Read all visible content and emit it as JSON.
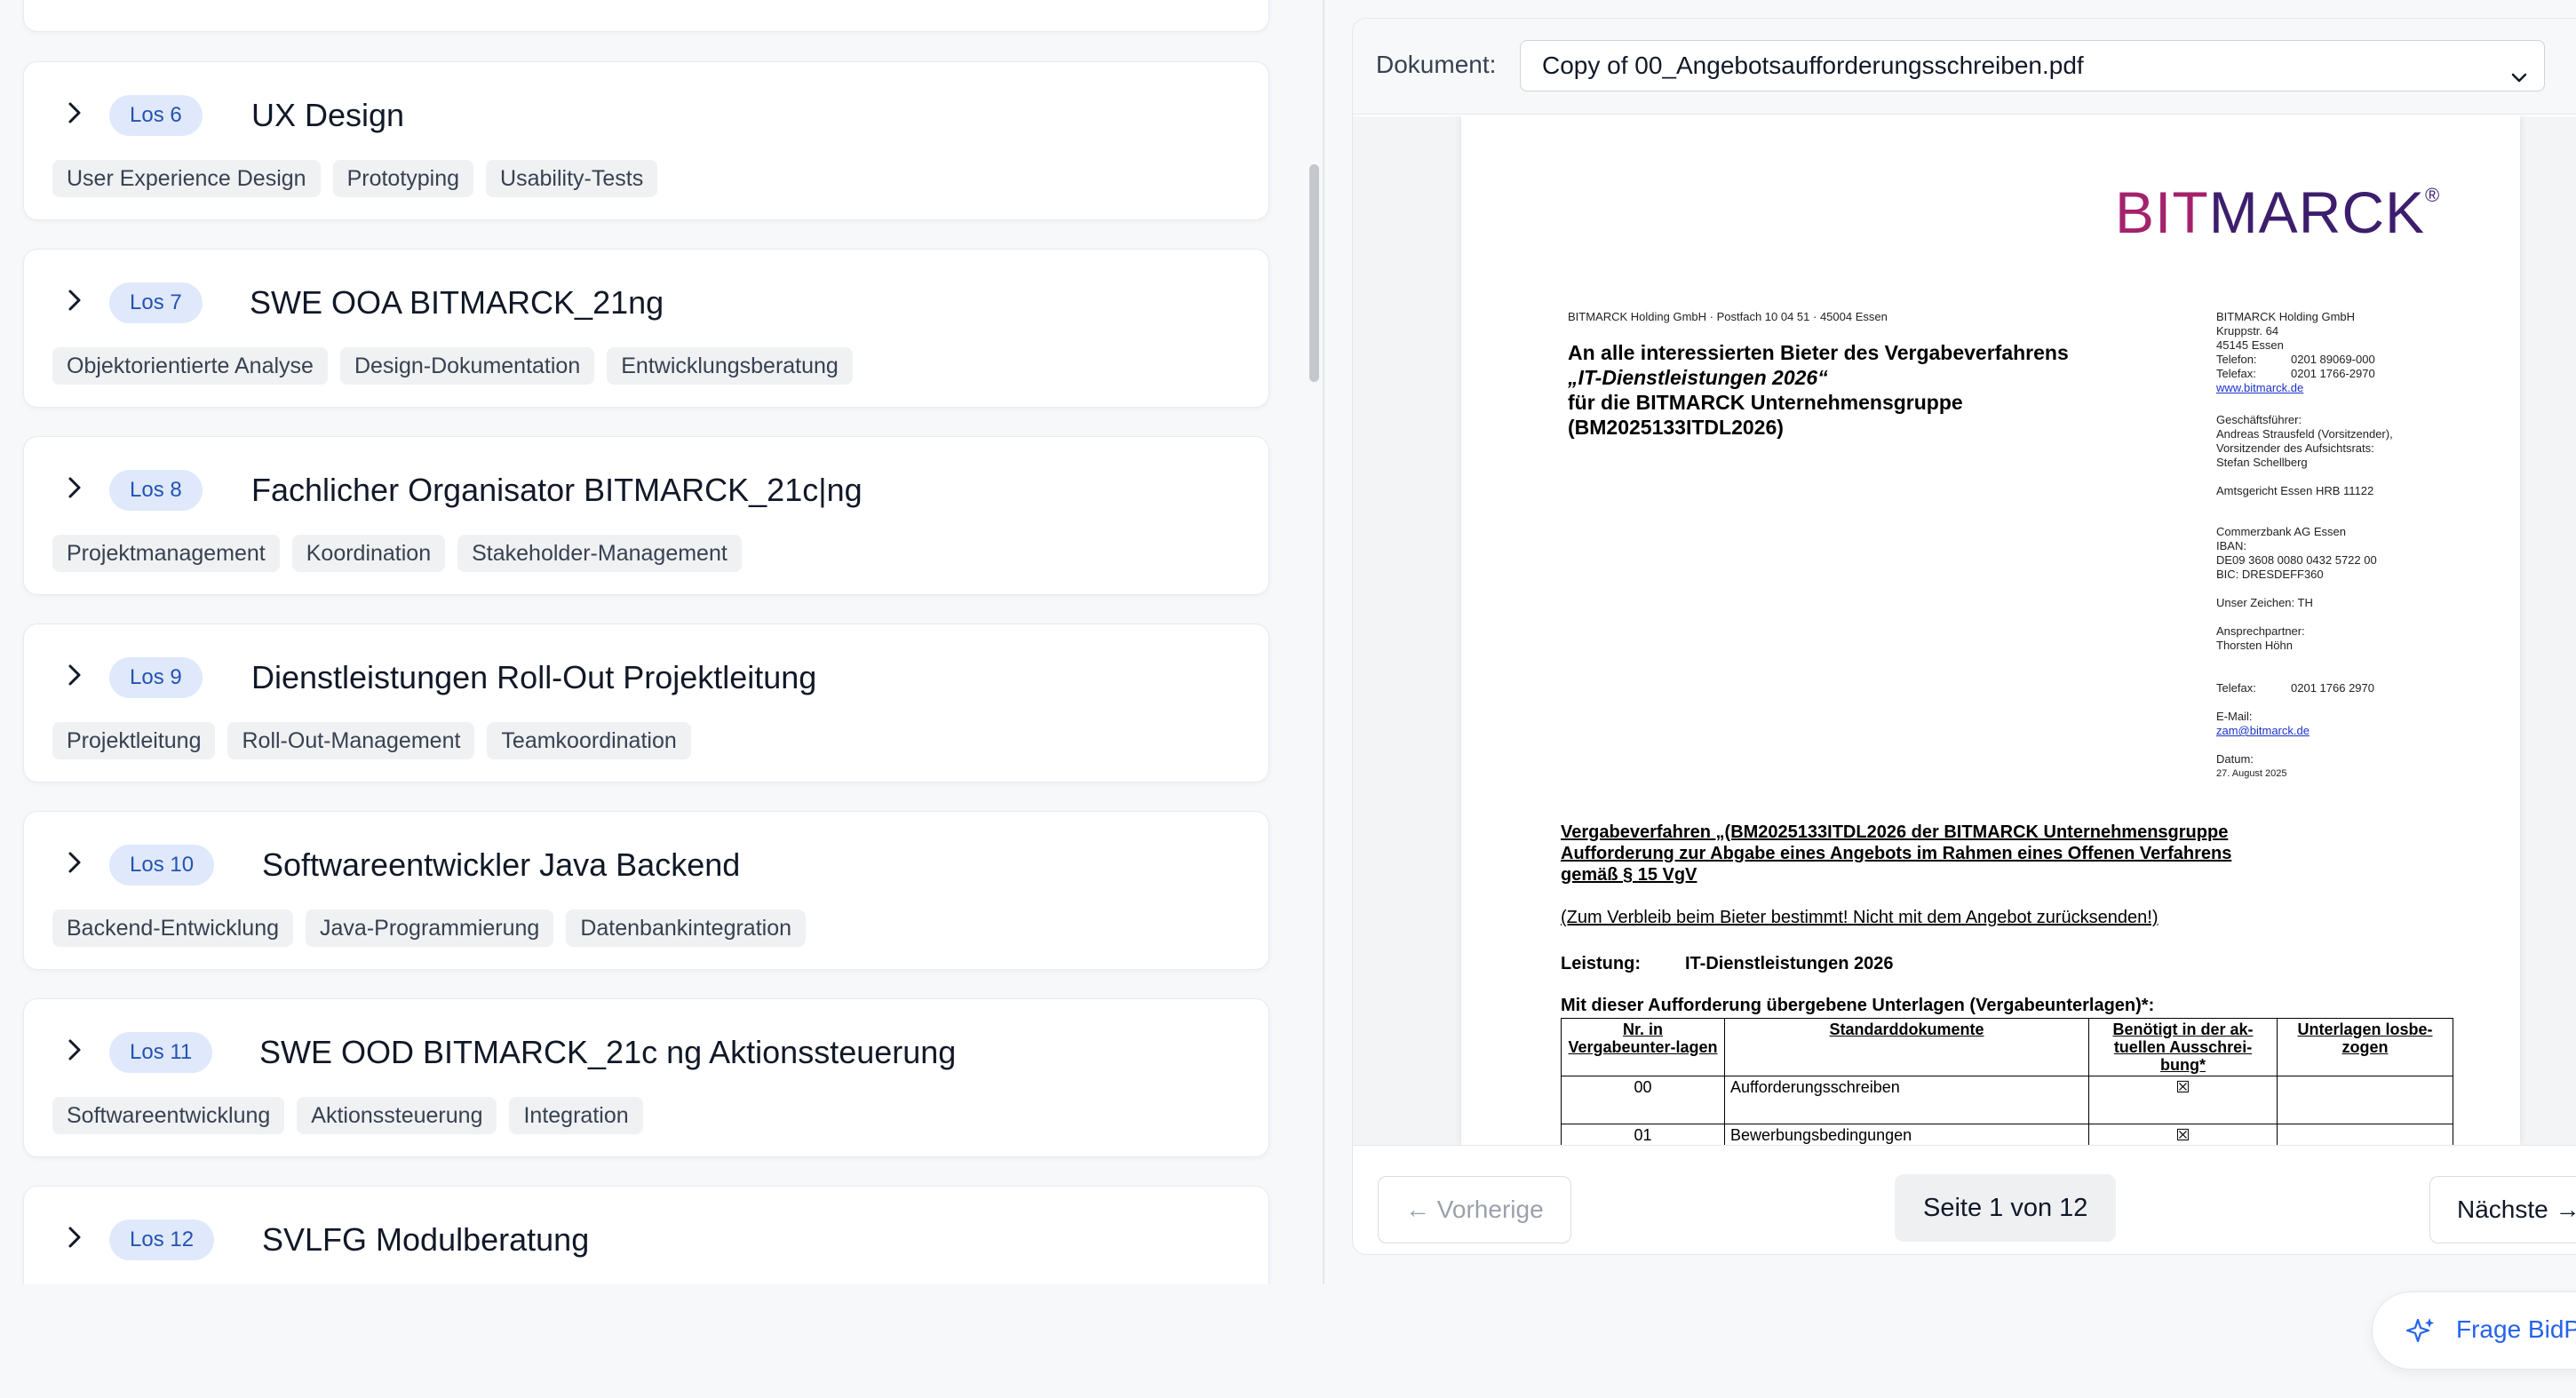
{
  "lose": [
    {
      "badge": "Los 6",
      "title": "UX Design",
      "tags": [
        "User Experience Design",
        "Prototyping",
        "Usability-Tests"
      ]
    },
    {
      "badge": "Los 7",
      "title": "SWE OOA BITMARCK_21ng",
      "tags": [
        "Objektorientierte Analyse",
        "Design-Dokumentation",
        "Entwicklungsberatung"
      ]
    },
    {
      "badge": "Los 8",
      "title": "Fachlicher Organisator BITMARCK_21c|ng",
      "tags": [
        "Projektmanagement",
        "Koordination",
        "Stakeholder-Management"
      ]
    },
    {
      "badge": "Los 9",
      "title": "Dienstleistungen Roll-Out Projektleitung",
      "tags": [
        "Projektleitung",
        "Roll-Out-Management",
        "Teamkoordination"
      ]
    },
    {
      "badge": "Los 10",
      "title": "Softwareentwickler Java Backend",
      "tags": [
        "Backend-Entwicklung",
        "Java-Programmierung",
        "Datenbankintegration"
      ]
    },
    {
      "badge": "Los 11",
      "title": "SWE OOD BITMARCK_21c ng Aktionssteuerung",
      "tags": [
        "Softwareentwicklung",
        "Aktionssteuerung",
        "Integration"
      ]
    },
    {
      "badge": "Los 12",
      "title": "SVLFG Modulberatung",
      "tags": []
    }
  ],
  "document": {
    "label": "Dokument:",
    "selected": "Copy of 00_Angebotsaufforderungsschreiben.pdf"
  },
  "pdf": {
    "logo_bit": "BIT",
    "logo_marck": "MARCK",
    "logo_reg": "®",
    "sender_line": "BITMARCK Holding GmbH · Postfach 10 04 51 · 45004 Essen",
    "recipient": [
      "An alle interessierten Bieter des Vergabeverfahrens",
      "„IT-Dienstleistungen 2026“",
      "für die BITMARCK Unternehmensgruppe",
      "(BM2025133ITDL2026)"
    ],
    "address": [
      "BITMARCK Holding GmbH",
      "Kruppstr. 64",
      "45145 Essen",
      "Telefon:",
      "0201 89069-000",
      "Telefax:",
      "0201 1766-2970",
      "www.bitmarck.de"
    ],
    "management": [
      "Geschäftsführer:",
      "Andreas Strausfeld (Vorsitzender),",
      "Vorsitzender des Aufsichtsrats:",
      "Stefan Schellberg"
    ],
    "court": "Amtsgericht Essen HRB 11122",
    "bank": [
      "Commerzbank AG Essen",
      "IBAN:",
      "DE09 3608 0080 0432 5722 00",
      "BIC: DRESDEFF360"
    ],
    "reference": "Unser Zeichen: TH",
    "contact": [
      "Ansprechpartner:",
      "Thorsten Höhn"
    ],
    "fax_label": "Telefax:",
    "fax_value": "0201 1766 2970",
    "email_label": "E-Mail:",
    "email": "zam@bitmarck.de",
    "date_label": "Datum:",
    "date": "27. August 2025",
    "subject": [
      "Vergabeverfahren „(BM2025133ITDL2026 der BITMARCK Unternehmensgruppe",
      "Aufforderung zur Abgabe eines Angebots im Rahmen eines Offenen Verfahrens",
      "gemäß § 15 VgV"
    ],
    "note": "(Zum Verbleib beim Bieter bestimmt! Nicht mit dem Angebot zurücksenden!)",
    "leistung_label": "Leistung:",
    "leistung_value": "IT-Dienstleistungen 2026",
    "table_intro": "Mit dieser Aufforderung übergebene Unterlagen (Vergabeunterlagen)*:",
    "table_headers": [
      "Nr. in Vergabeunter-lagen",
      "Standarddokumente",
      "Benötigt in der ak-tuellen Ausschrei-bung*",
      "Unterlagen losbe-zogen"
    ],
    "table_rows": [
      {
        "nr": "00",
        "doc": "Aufforderungsschreiben",
        "needed": "☒",
        "los": ""
      },
      {
        "nr": "01",
        "doc": "Bewerbungsbedingungen",
        "needed": "☒",
        "los": ""
      }
    ]
  },
  "pagination": {
    "prev": "← Vorherige",
    "indicator": "Seite 1 von 12",
    "next": "Nächste →"
  },
  "assistant": {
    "label": "Frage BidPilot"
  },
  "colors": {
    "badge_bg": "#dfe9fb",
    "badge_text": "#2452b2",
    "accent": "#2563eb",
    "logo_purple": "#3d1e6d",
    "logo_magenta": "#a3226b"
  }
}
